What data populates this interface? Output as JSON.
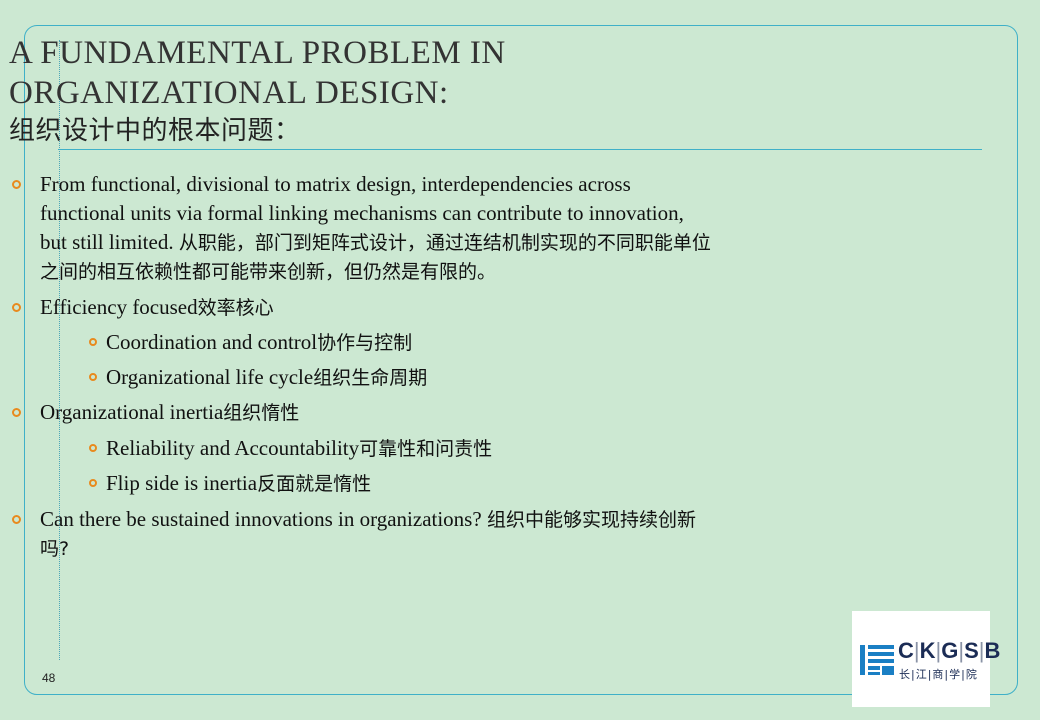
{
  "slide": {
    "title_line1": "A FUNDAMENTAL PROBLEM IN",
    "title_line2": "ORGANIZATIONAL DESIGN:",
    "title_zh": "组织设计中的根本问题：",
    "page_number": "48"
  },
  "bullets": {
    "b1": {
      "l1": "From functional, divisional to matrix design, interdependencies across",
      "l2": "functional units via formal linking mechanisms can contribute to innovation,",
      "l3a": "but still limited. ",
      "l3b": "从职能，部门到矩阵式设计，通过连结机制实现的不同职能单位",
      "l4": "之间的相互依赖性都可能带来创新，但仍然是有限的。"
    },
    "b2": {
      "en": "Efficiency focused",
      "zh": "效率核心"
    },
    "b2a": {
      "en": "Coordination and control",
      "zh": "协作与控制"
    },
    "b2b": {
      "en": "Organizational life cycle",
      "zh": "组织生命周期"
    },
    "b3": {
      "en": "Organizational inertia",
      "zh": "组织惰性"
    },
    "b3a": {
      "en": "Reliability and Accountability",
      "zh": "可靠性和问责性"
    },
    "b3b": {
      "en": "Flip side is inertia",
      "zh": "反面就是惰性"
    },
    "b4": {
      "en": "Can there be sustained innovations in organizations? ",
      "zh": "组织中能够实现持续创新",
      "l2": "吗?"
    }
  },
  "logo": {
    "c": "C",
    "k": "K",
    "g": "G",
    "s": "S",
    "b": "B",
    "zh": "长|江|商|学|院",
    "mark_icon": "ckgsb-emblem-icon"
  },
  "colors": {
    "background": "#cce8d2",
    "accent_line": "#3fb0c8",
    "bullet_marker": "#e88a1e",
    "logo_blue": "#1b2c55"
  }
}
